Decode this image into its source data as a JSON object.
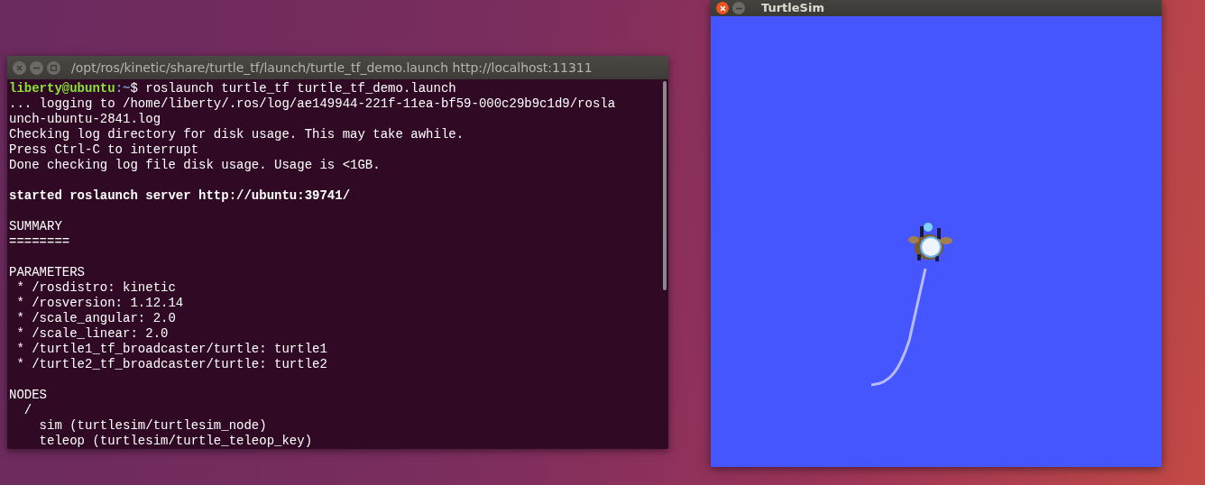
{
  "terminal": {
    "title": "/opt/ros/kinetic/share/turtle_tf/launch/turtle_tf_demo.launch http://localhost:11311",
    "lines": [
      {
        "kind": "prompt",
        "user": "liberty@ubuntu",
        "path": ":~",
        "command": "$ roslaunch turtle_tf turtle_tf_demo.launch"
      },
      {
        "kind": "plain",
        "text": "... logging to /home/liberty/.ros/log/ae149944-221f-11ea-bf59-000c29b9c1d9/rosla"
      },
      {
        "kind": "plain",
        "text": "unch-ubuntu-2841.log"
      },
      {
        "kind": "plain",
        "text": "Checking log directory for disk usage. This may take awhile."
      },
      {
        "kind": "plain",
        "text": "Press Ctrl-C to interrupt"
      },
      {
        "kind": "plain",
        "text": "Done checking log file disk usage. Usage is <1GB."
      },
      {
        "kind": "blank"
      },
      {
        "kind": "bold",
        "text": "started roslaunch server http://ubuntu:39741/"
      },
      {
        "kind": "blank"
      },
      {
        "kind": "plain",
        "text": "SUMMARY"
      },
      {
        "kind": "plain",
        "text": "========"
      },
      {
        "kind": "blank"
      },
      {
        "kind": "plain",
        "text": "PARAMETERS"
      },
      {
        "kind": "plain",
        "text": " * /rosdistro: kinetic"
      },
      {
        "kind": "plain",
        "text": " * /rosversion: 1.12.14"
      },
      {
        "kind": "plain",
        "text": " * /scale_angular: 2.0"
      },
      {
        "kind": "plain",
        "text": " * /scale_linear: 2.0"
      },
      {
        "kind": "plain",
        "text": " * /turtle1_tf_broadcaster/turtle: turtle1"
      },
      {
        "kind": "plain",
        "text": " * /turtle2_tf_broadcaster/turtle: turtle2"
      },
      {
        "kind": "blank"
      },
      {
        "kind": "plain",
        "text": "NODES"
      },
      {
        "kind": "plain",
        "text": "  /"
      },
      {
        "kind": "plain",
        "text": "    sim (turtlesim/turtlesim_node)"
      },
      {
        "kind": "plain",
        "text": "    teleop (turtlesim/turtle_teleop_key)"
      }
    ]
  },
  "turtlesim": {
    "title": "TurtleSim"
  }
}
